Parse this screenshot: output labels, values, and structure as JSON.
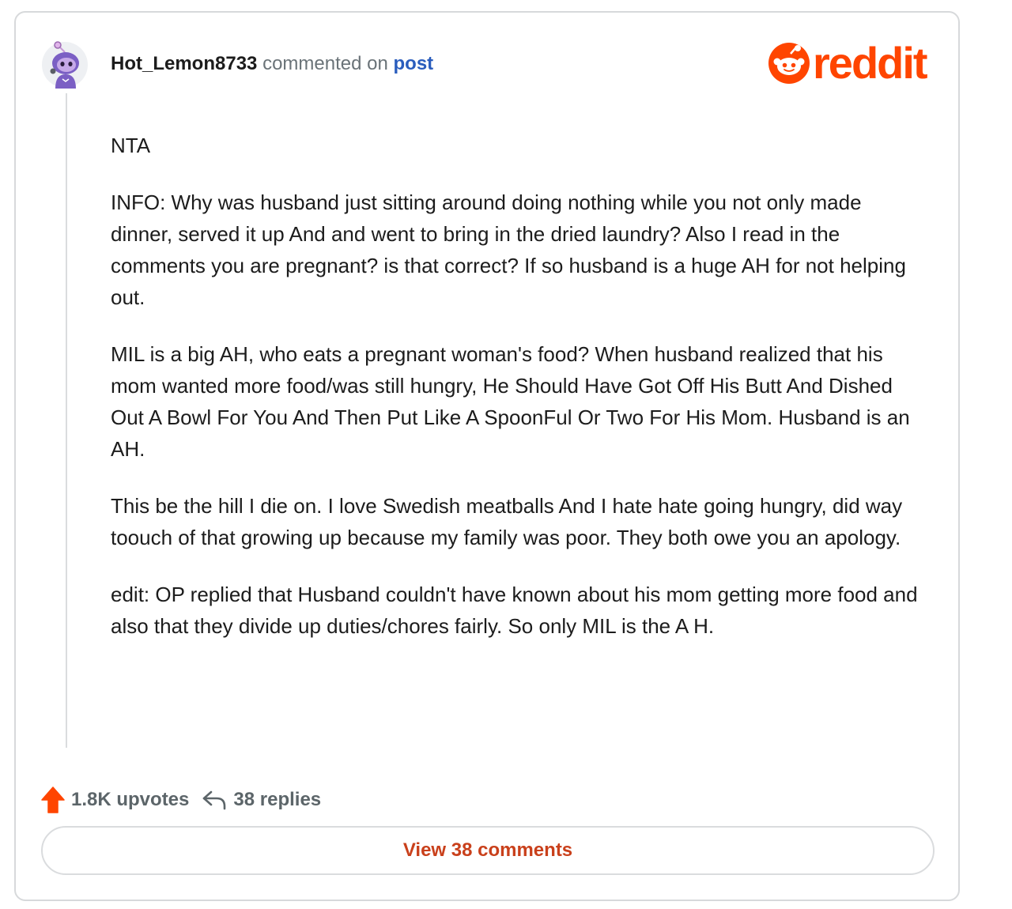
{
  "header": {
    "username": "Hot_Lemon8733",
    "commented_text": "commented on",
    "post_link": "post"
  },
  "brand": {
    "logo_text": "reddit",
    "color": "#ff4500"
  },
  "comment": {
    "paragraphs": [
      "NTA",
      "INFO: Why was husband just sitting around doing nothing while you not only made dinner, served it up And and went to bring in the dried laundry? Also I read in the comments you are pregnant? is that correct? If so husband is a huge AH for not helping out.",
      "MIL is a big AH, who eats a pregnant woman's food? When husband realized that his mom wanted more food/was still hungry, He Should Have Got Off His Butt And Dished Out A Bowl For You And Then Put Like A SpoonFul Or Two For His Mom. Husband is an AH.",
      "This be the hill I die on. I love Swedish meatballs And I hate hate going hungry, did way toouch of that growing up because my family was poor. They both owe you an apology.",
      "edit: OP replied that Husband couldn't have known about his mom getting more food and also that they divide up duties/chores fairly. So only MIL is the A H."
    ]
  },
  "footer": {
    "upvotes": "1.8K upvotes",
    "replies": "38 replies",
    "upvote_icon": "upvote-arrow-icon",
    "reply_icon": "reply-arrow-icon",
    "upvote_color": "#ff4500"
  },
  "view_button": {
    "label": "View 38 comments"
  },
  "avatar": {
    "icon": "snoo-avatar-icon",
    "color": "#7b5fc4"
  }
}
